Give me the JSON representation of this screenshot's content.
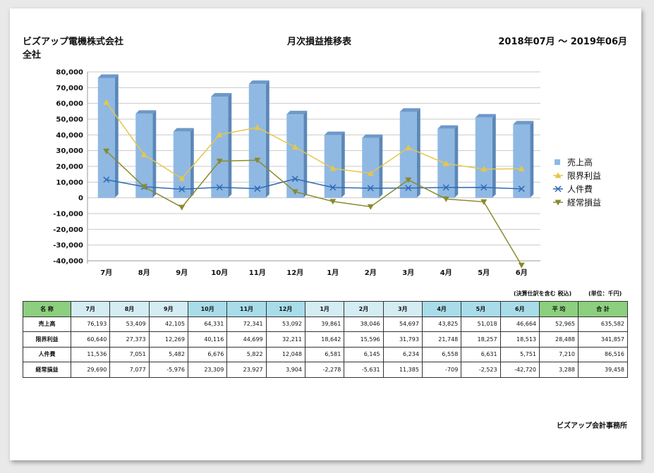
{
  "header": {
    "company": "ビズアップ電機株式会社",
    "scope": "全社",
    "title": "月次損益推移表",
    "period": "2018年07月 〜 2019年06月"
  },
  "notes": {
    "tax": "(決算仕訳を含む 税込)",
    "unit": "(単位：千円)"
  },
  "footer": "ビズアップ会計事務所",
  "colors": {
    "bar": "#8fb9e3",
    "bar_side": "#5b88b8",
    "bar_top": "#6d99c8",
    "limit_profit": "#e6c64b",
    "personnel": "#2f6bb5",
    "ordinary_profit": "#8a8a2c"
  },
  "chart_data": {
    "type": "bar",
    "categories": [
      "7月",
      "8月",
      "9月",
      "10月",
      "11月",
      "12月",
      "1月",
      "2月",
      "3月",
      "4月",
      "5月",
      "6月"
    ],
    "ylim": [
      -40000,
      80000
    ],
    "yticks": [
      "80,000",
      "70,000",
      "60,000",
      "50,000",
      "40,000",
      "30,000",
      "20,000",
      "10,000",
      "0",
      "-10,000",
      "-20,000",
      "-30,000",
      "-40,000"
    ],
    "grid": true,
    "legend_position": "right",
    "series": [
      {
        "name": "売上高",
        "kind": "bar",
        "marker": "square",
        "values": [
          76193,
          53409,
          42105,
          64331,
          72341,
          53092,
          39861,
          38046,
          54697,
          43825,
          51018,
          46664
        ]
      },
      {
        "name": "限界利益",
        "kind": "line",
        "marker": "triangle-up",
        "values": [
          60640,
          27373,
          12269,
          40116,
          44699,
          32211,
          18642,
          15596,
          31793,
          21748,
          18257,
          18513
        ]
      },
      {
        "name": "人件費",
        "kind": "line",
        "marker": "x",
        "values": [
          11536,
          7051,
          5482,
          6676,
          5822,
          12048,
          6581,
          6145,
          6234,
          6558,
          6631,
          5751
        ]
      },
      {
        "name": "経常損益",
        "kind": "line",
        "marker": "triangle-down",
        "values": [
          29690,
          7077,
          -5976,
          23309,
          23927,
          3904,
          -2278,
          -5631,
          11385,
          -709,
          -2523,
          -42720
        ]
      }
    ]
  },
  "table": {
    "headers": [
      "名 称",
      "7月",
      "8月",
      "9月",
      "10月",
      "11月",
      "12月",
      "1月",
      "2月",
      "3月",
      "4月",
      "5月",
      "6月",
      "平 均",
      "合 計"
    ],
    "rows": [
      {
        "label": "売上高",
        "cells": [
          "76,193",
          "53,409",
          "42,105",
          "64,331",
          "72,341",
          "53,092",
          "39,861",
          "38,046",
          "54,697",
          "43,825",
          "51,018",
          "46,664",
          "52,965",
          "635,582"
        ]
      },
      {
        "label": "限界利益",
        "cells": [
          "60,640",
          "27,373",
          "12,269",
          "40,116",
          "44,699",
          "32,211",
          "18,642",
          "15,596",
          "31,793",
          "21,748",
          "18,257",
          "18,513",
          "28,488",
          "341,857"
        ]
      },
      {
        "label": "人件費",
        "cells": [
          "11,536",
          "7,051",
          "5,482",
          "6,676",
          "5,822",
          "12,048",
          "6,581",
          "6,145",
          "6,234",
          "6,558",
          "6,631",
          "5,751",
          "7,210",
          "86,516"
        ]
      },
      {
        "label": "経常損益",
        "cells": [
          "29,690",
          "7,077",
          "-5,976",
          "23,309",
          "23,927",
          "3,904",
          "-2,278",
          "-5,631",
          "11,385",
          "-709",
          "-2,523",
          "-42,720",
          "3,288",
          "39,458"
        ]
      }
    ]
  }
}
